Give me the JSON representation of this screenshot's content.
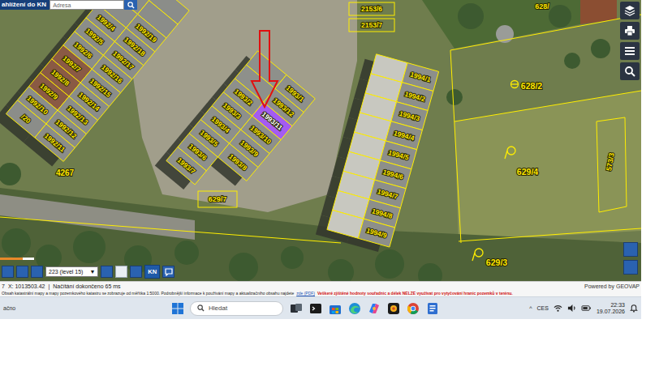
{
  "header": {
    "title": "ahlížení do KN",
    "search": {
      "placeholder": "Adresa"
    }
  },
  "map": {
    "parcels": [
      {
        "label": "1992/19",
        "selected": false
      },
      {
        "label": "1992/18",
        "selected": false
      },
      {
        "label": "1992/17",
        "selected": false
      },
      {
        "label": "1992/16",
        "selected": false
      },
      {
        "label": "1992/15",
        "selected": false
      },
      {
        "label": "1992/14",
        "selected": false
      },
      {
        "label": "1992/13",
        "selected": false
      },
      {
        "label": "1992/12",
        "selected": false
      },
      {
        "label": "1992/11",
        "selected": false
      },
      {
        "label": "1992/4",
        "selected": false
      },
      {
        "label": "1992/5",
        "selected": false
      },
      {
        "label": "1992/6",
        "selected": false
      },
      {
        "label": "1992/7",
        "selected": false
      },
      {
        "label": "1992/8",
        "selected": false
      },
      {
        "label": "1992/9",
        "selected": false
      },
      {
        "label": "1992/10",
        "selected": false
      },
      {
        "label": "/20",
        "selected": false
      },
      {
        "label": "4267",
        "selected": false
      },
      {
        "label": "2153/6",
        "selected": false
      },
      {
        "label": "2153/7",
        "selected": false
      },
      {
        "label": "1993/1",
        "selected": false
      },
      {
        "label": "1993/12",
        "selected": false
      },
      {
        "label": "1993/11",
        "selected": true
      },
      {
        "label": "1993/10",
        "selected": false
      },
      {
        "label": "1993/9",
        "selected": false
      },
      {
        "label": "1993/8",
        "selected": false
      },
      {
        "label": "1993/2",
        "selected": false
      },
      {
        "label": "1993/3",
        "selected": false
      },
      {
        "label": "1993/4",
        "selected": false
      },
      {
        "label": "1993/5",
        "selected": false
      },
      {
        "label": "1993/6",
        "selected": false
      },
      {
        "label": "1993/7",
        "selected": false
      },
      {
        "label": "629/7",
        "selected": false
      },
      {
        "label": "1994/1",
        "selected": false
      },
      {
        "label": "1994/2",
        "selected": false
      },
      {
        "label": "1994/3",
        "selected": false
      },
      {
        "label": "1994/4",
        "selected": false
      },
      {
        "label": "1994/5",
        "selected": false
      },
      {
        "label": "1994/6",
        "selected": false
      },
      {
        "label": "1994/7",
        "selected": false
      },
      {
        "label": "1994/8",
        "selected": false
      },
      {
        "label": "1994/9",
        "selected": false
      },
      {
        "label": "628/",
        "selected": false
      },
      {
        "label": "628/2",
        "selected": false
      },
      {
        "label": "629/4",
        "selected": false
      },
      {
        "label": "573/3",
        "selected": false
      },
      {
        "label": "629/3",
        "selected": false
      }
    ]
  },
  "toolbar": {
    "scale": {
      "value": "223 (level 15)",
      "arrow": "▼"
    },
    "kn": "KN"
  },
  "info": {
    "index": "7",
    "coords": "X: 1013503.42",
    "separator": "|",
    "load": "Načítání dokončeno 65 ms",
    "notice": "Obsah katastrální mapy a mapy pozemkového katastru se zobrazuje od měřítka 1:5000. Podrobnější informace k používání mapy a aktualizačního obsahu najdete",
    "link": "zde (PDF)",
    "warning": "Veškeré zjištěné hodnoty souřadnic a délek NELZE využívat pro vytyčování hranic pozemků v terénu.",
    "powered_by": "Powered by GEOVAP"
  },
  "taskbar": {
    "left_text": "ačno",
    "search": "Hledat",
    "overflow": "^",
    "language": "CES",
    "time": "22:33",
    "date": "19.07.2026"
  }
}
